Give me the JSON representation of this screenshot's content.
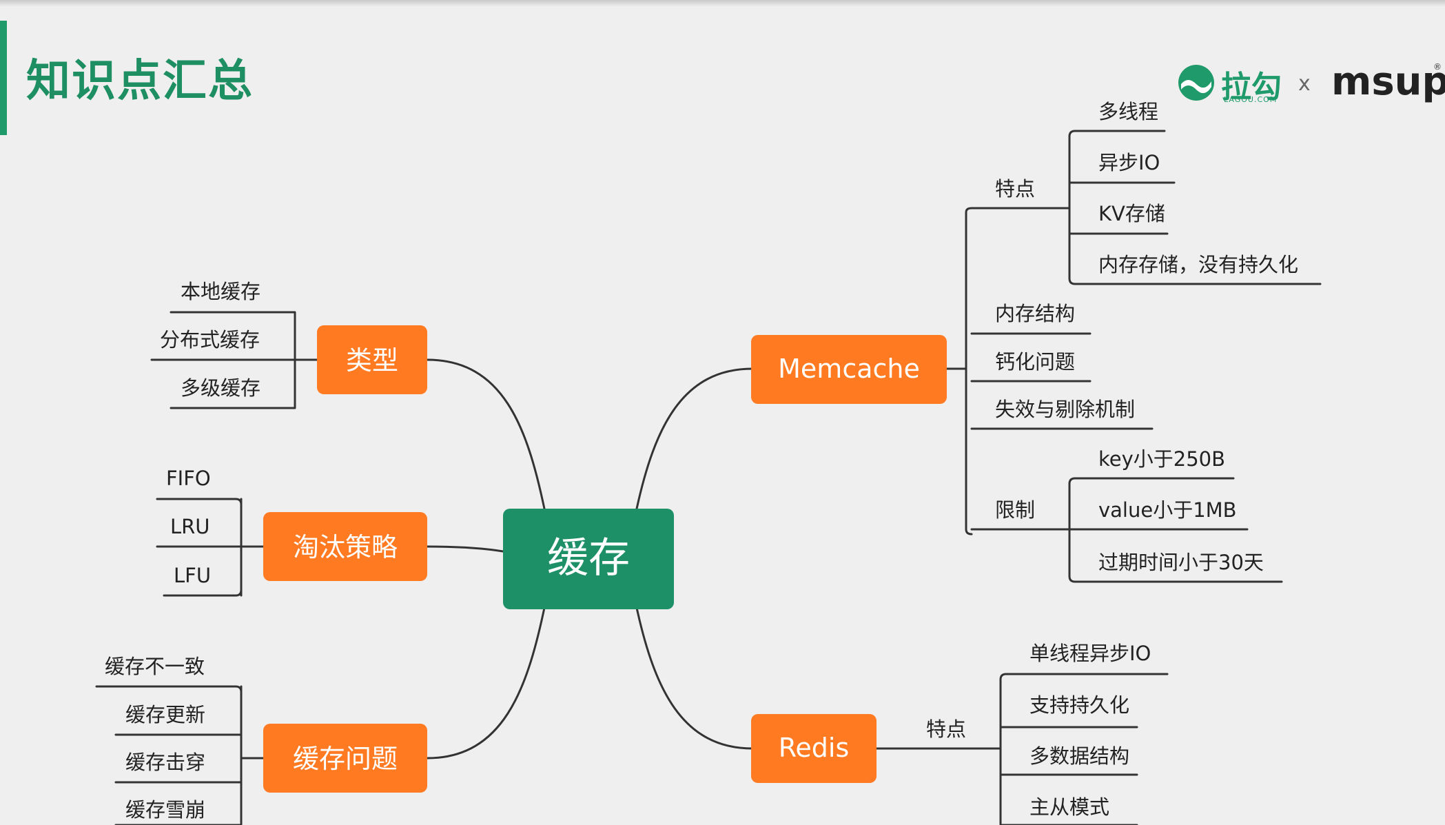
{
  "title": "知识点汇总",
  "logos": {
    "lagou_main": "拉勾",
    "lagou_sub": "LAGOU.COM",
    "separator": "x",
    "msup": "msup",
    "msup_reg": "®"
  },
  "colors": {
    "center_node": "#1d9068",
    "branch_node": "#ff7a21",
    "title": "#1e8f63",
    "line": "#333333",
    "background": "#efefef"
  },
  "mindmap": {
    "center": "缓存",
    "branches": {
      "types": {
        "label": "类型",
        "children": [
          "本地缓存",
          "分布式缓存",
          "多级缓存"
        ]
      },
      "eviction": {
        "label": "淘汰策略",
        "children": [
          "FIFO",
          "LRU",
          "LFU"
        ]
      },
      "problems": {
        "label": "缓存问题",
        "children": [
          "缓存不一致",
          "缓存更新",
          "缓存击穿",
          "缓存雪崩"
        ]
      },
      "memcache": {
        "label": "Memcache",
        "features_label": "特点",
        "features": [
          "多线程",
          "异步IO",
          "KV存储",
          "内存存储，没有持久化"
        ],
        "memory_structure": "内存结构",
        "calcification": "钙化问题",
        "expiry": "失效与剔除机制",
        "limits_label": "限制",
        "limits": [
          "key小于250B",
          "value小于1MB",
          "过期时间小于30天"
        ]
      },
      "redis": {
        "label": "Redis",
        "features_label": "特点",
        "features": [
          "单线程异步IO",
          "支持持久化",
          "多数据结构",
          "主从模式"
        ]
      }
    }
  }
}
